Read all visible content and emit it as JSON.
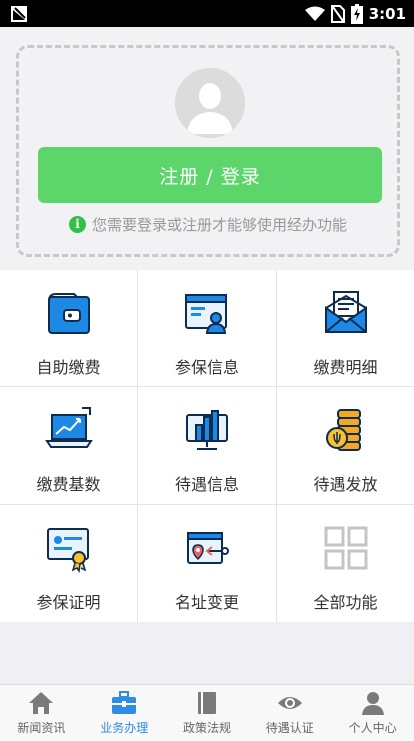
{
  "status_bar": {
    "time": "3:01"
  },
  "login": {
    "button_label": "注册 / 登录",
    "hint": "您需要登录或注册才能够使用经办功能"
  },
  "grid": {
    "items": [
      {
        "label": "自助缴费",
        "icon": "wallet-icon"
      },
      {
        "label": "参保信息",
        "icon": "id-card-icon"
      },
      {
        "label": "缴费明细",
        "icon": "envelope-icon"
      },
      {
        "label": "缴费基数",
        "icon": "laptop-chart-icon"
      },
      {
        "label": "待遇信息",
        "icon": "bar-chart-monitor-icon"
      },
      {
        "label": "待遇发放",
        "icon": "coin-stack-icon"
      },
      {
        "label": "参保证明",
        "icon": "certificate-icon"
      },
      {
        "label": "名址变更",
        "icon": "address-card-icon"
      },
      {
        "label": "全部功能",
        "icon": "grid-icon"
      }
    ]
  },
  "bottom_nav": {
    "active": "业务办理",
    "items": [
      {
        "label": "新闻资讯",
        "icon": "home-icon"
      },
      {
        "label": "业务办理",
        "icon": "briefcase-icon"
      },
      {
        "label": "政策法规",
        "icon": "book-icon"
      },
      {
        "label": "待遇认证",
        "icon": "eye-icon"
      },
      {
        "label": "个人中心",
        "icon": "person-icon"
      }
    ]
  },
  "colors": {
    "primary_green": "#5cd66b",
    "active_blue": "#2e8be6",
    "icon_blue": "#2196e8"
  }
}
